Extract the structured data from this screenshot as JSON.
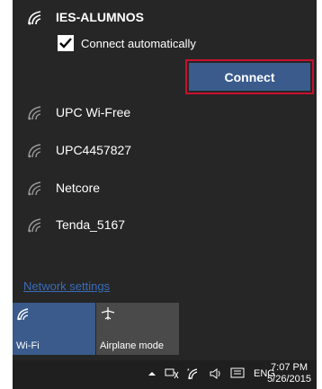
{
  "networks": [
    {
      "name": "IES-ALUMNOS",
      "connected_state": "selected"
    },
    {
      "name": "UPC Wi-Free"
    },
    {
      "name": "UPC4457827"
    },
    {
      "name": "Netcore"
    },
    {
      "name": "Tenda_5167"
    }
  ],
  "auto_connect": {
    "label": "Connect automatically",
    "checked": true
  },
  "connect_button": {
    "label": "Connect"
  },
  "network_settings_link": "Network settings",
  "quick_actions": [
    {
      "label": "Wi-Fi",
      "icon": "wifi-icon",
      "active": true
    },
    {
      "label": "Airplane mode",
      "icon": "airplane-icon",
      "active": false
    }
  ],
  "taskbar": {
    "language": "ENG",
    "time": "7:07 PM",
    "date": "5/26/2015"
  },
  "colors": {
    "panel_bg": "#262626",
    "accent": "#3a5b8c",
    "highlight_border": "#c8102e",
    "link": "#3a6cb6"
  }
}
